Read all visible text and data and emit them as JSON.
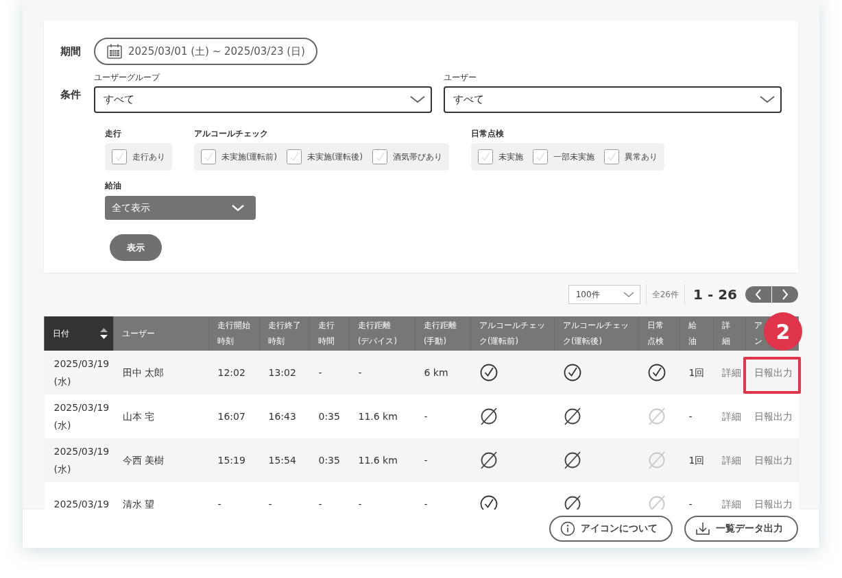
{
  "period": {
    "label": "期間",
    "value": "2025/03/01 (土) ~ 2025/03/23 (日)"
  },
  "conditions": {
    "label": "条件",
    "selects": [
      {
        "label": "ユーザーグループ",
        "value": "すべて"
      },
      {
        "label": "ユーザー",
        "value": "すべて"
      }
    ],
    "check_groups": [
      {
        "label": "走行",
        "options": [
          {
            "label": "走行あり",
            "checked": false
          }
        ]
      },
      {
        "label": "アルコールチェック",
        "options": [
          {
            "label": "未実施(運転前)",
            "checked": false
          },
          {
            "label": "未実施(運転後)",
            "checked": false
          },
          {
            "label": "酒気帯びあり",
            "checked": false
          }
        ]
      },
      {
        "label": "日常点検",
        "options": [
          {
            "label": "未実施",
            "checked": false
          },
          {
            "label": "一部未実施",
            "checked": false
          },
          {
            "label": "異常あり",
            "checked": false
          }
        ]
      }
    ],
    "fuel": {
      "label": "給油",
      "value": "全て表示"
    },
    "submit": "表示"
  },
  "pagination": {
    "per_page": "100件",
    "total": "全26件",
    "range": "1 - 26"
  },
  "table": {
    "columns": [
      {
        "lines": [
          "日付"
        ],
        "sorted": true
      },
      {
        "lines": [
          "ユーザー"
        ],
        "sorted": false
      },
      {
        "lines": [
          "走行開始",
          "時刻"
        ],
        "sorted": false
      },
      {
        "lines": [
          "走行終了",
          "時刻"
        ],
        "sorted": false
      },
      {
        "lines": [
          "走行",
          "時間"
        ],
        "sorted": false
      },
      {
        "lines": [
          "走行距離",
          "(デバイス)"
        ],
        "sorted": false
      },
      {
        "lines": [
          "走行距離",
          "(手動)"
        ],
        "sorted": false
      },
      {
        "lines": [
          "アルコールチェッ",
          "ク(運転前)"
        ],
        "sorted": false
      },
      {
        "lines": [
          "アルコールチェッ",
          "ク(運転後)"
        ],
        "sorted": false
      },
      {
        "lines": [
          "日常",
          "点検"
        ],
        "sorted": false
      },
      {
        "lines": [
          "給",
          "油"
        ],
        "sorted": false
      },
      {
        "lines": [
          "詳",
          "細"
        ],
        "sorted": false
      },
      {
        "lines": [
          "ア",
          "ン"
        ],
        "sorted": false
      }
    ],
    "rows": [
      {
        "date": "2025/03/19",
        "day": "(水)",
        "user": "田中 太郎",
        "start": "12:02",
        "end": "13:02",
        "duration": "-",
        "distance_device": "-",
        "distance_manual": "6 km",
        "checks": [
          {
            "kind": "check",
            "disabled": false
          },
          {
            "kind": "check",
            "disabled": false
          },
          {
            "kind": "check",
            "disabled": false
          }
        ],
        "fuel": "1回",
        "detail": "詳細",
        "action": "日報出力",
        "highlighted": true
      },
      {
        "date": "2025/03/19",
        "day": "(水)",
        "user": "山本 宅",
        "start": "16:07",
        "end": "16:43",
        "duration": "0:35",
        "distance_device": "11.6 km",
        "distance_manual": "-",
        "checks": [
          {
            "kind": "slash",
            "disabled": false
          },
          {
            "kind": "slash",
            "disabled": false
          },
          {
            "kind": "slash",
            "disabled": true
          }
        ],
        "fuel": "-",
        "detail": "詳細",
        "action": "日報出力",
        "highlighted": false
      },
      {
        "date": "2025/03/19",
        "day": "(水)",
        "user": "今西 美樹",
        "start": "15:19",
        "end": "15:54",
        "duration": "0:35",
        "distance_device": "11.6 km",
        "distance_manual": "-",
        "checks": [
          {
            "kind": "slash",
            "disabled": false
          },
          {
            "kind": "slash",
            "disabled": false
          },
          {
            "kind": "slash",
            "disabled": true
          }
        ],
        "fuel": "1回",
        "detail": "詳細",
        "action": "日報出力",
        "highlighted": false
      },
      {
        "date": "2025/03/19",
        "user": "清水 望",
        "start": "-",
        "end": "-",
        "duration": "-",
        "distance_device": "-",
        "distance_manual": "-",
        "checks": [
          {
            "kind": "check",
            "disabled": false
          },
          {
            "kind": "slash",
            "disabled": false
          },
          {
            "kind": "slash",
            "disabled": true
          }
        ],
        "fuel": "-",
        "detail": "詳細",
        "action": "日報出力",
        "highlighted": false
      }
    ]
  },
  "callout": {
    "number": "2"
  },
  "footer": {
    "buttons": [
      {
        "kind": "info",
        "label": "アイコンについて"
      },
      {
        "kind": "download",
        "label": "一覧データ出力"
      }
    ]
  }
}
